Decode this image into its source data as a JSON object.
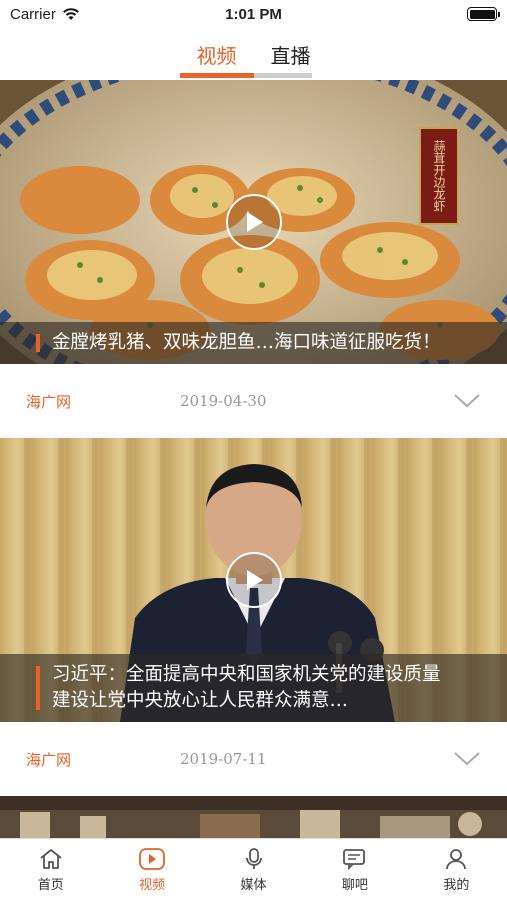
{
  "status_bar": {
    "carrier": "Carrier",
    "time": "1:01 PM"
  },
  "top_tabs": [
    {
      "label": "视频",
      "active": true
    },
    {
      "label": "直播",
      "active": false
    }
  ],
  "feed": [
    {
      "title": "金膛烤乳猪、双味龙胆鱼…海口味道征服吃货！",
      "dish_sign": "蒜茸开边龙虾",
      "source": "海广网",
      "date": "2019-04-30"
    },
    {
      "title": "习近平：全面提高中央和国家机关党的建设质量 建设让党中央放心让人民群众满意…",
      "source": "海广网",
      "date": "2019-07-11"
    }
  ],
  "bottom_nav": [
    {
      "label": "首页",
      "icon": "home-icon",
      "active": false
    },
    {
      "label": "视频",
      "icon": "video-play-icon",
      "active": true
    },
    {
      "label": "媒体",
      "icon": "microphone-icon",
      "active": false
    },
    {
      "label": "聊吧",
      "icon": "chat-bubbles-icon",
      "active": false
    },
    {
      "label": "我的",
      "icon": "user-icon",
      "active": false
    }
  ],
  "colors": {
    "accent": "#e8622a",
    "date_text": "#999999"
  }
}
